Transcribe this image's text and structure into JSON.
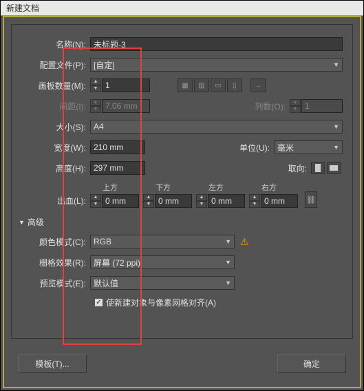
{
  "window": {
    "title": "新建文档"
  },
  "fields": {
    "name": {
      "label": "名称(N):",
      "value": "未标题-3"
    },
    "profile": {
      "label": "配置文件(P):",
      "value": "[自定]"
    },
    "artboards": {
      "label": "画板数量(M):",
      "value": "1"
    },
    "spacing": {
      "label": "间距(I):",
      "value": "7.06 mm"
    },
    "columns": {
      "label": "列数(O):",
      "value": "1"
    },
    "size": {
      "label": "大小(S):",
      "value": "A4"
    },
    "width": {
      "label": "宽度(W):",
      "value": "210 mm"
    },
    "units": {
      "label": "单位(U):",
      "value": "毫米"
    },
    "height": {
      "label": "高度(H):",
      "value": "297 mm"
    },
    "orientation": {
      "label": "取向:"
    },
    "bleed": {
      "label": "出血(L):",
      "top": {
        "label": "上方",
        "value": "0 mm"
      },
      "bottom": {
        "label": "下方",
        "value": "0 mm"
      },
      "left": {
        "label": "左方",
        "value": "0 mm"
      },
      "right": {
        "label": "右方",
        "value": "0 mm"
      }
    }
  },
  "advanced": {
    "header": "高级",
    "colorMode": {
      "label": "颜色模式(C):",
      "value": "RGB"
    },
    "raster": {
      "label": "栅格效果(R):",
      "value": "屏幕 (72 ppi)"
    },
    "preview": {
      "label": "预览模式(E):",
      "value": "默认值"
    },
    "alignGrid": {
      "label": "使新建对象与像素网格对齐(A)",
      "checked": "✓"
    }
  },
  "buttons": {
    "template": "模板(T)...",
    "ok": "确定"
  },
  "icons": {
    "arrowRight": "→"
  }
}
